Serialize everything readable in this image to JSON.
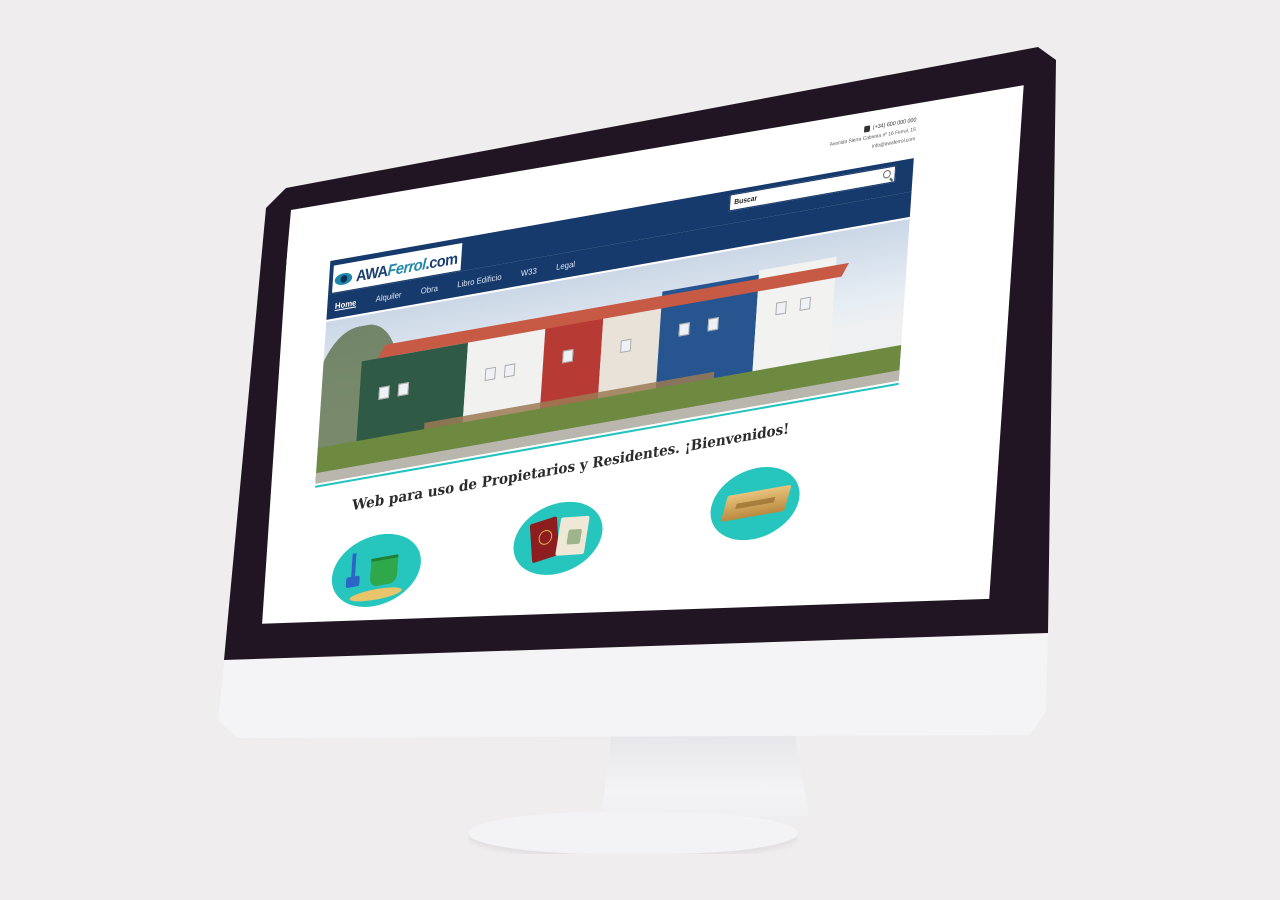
{
  "site": {
    "logo_main": "AWA",
    "logo_accent": "Ferrol",
    "logo_suffix": ".com",
    "contact": {
      "phone": "(+34) 600 000 000",
      "address": "Avenida Sierra Cabreira nº 16 Ferrol, 15",
      "email": "info@awaferrol.com"
    },
    "search": {
      "placeholder": "Buscar"
    },
    "nav": [
      {
        "label": "Home",
        "active": true
      },
      {
        "label": "Alquiler",
        "active": false
      },
      {
        "label": "Obra",
        "active": false
      },
      {
        "label": "Libro Edificio",
        "active": false
      },
      {
        "label": "W33",
        "active": false
      },
      {
        "label": "Legal",
        "active": false
      }
    ],
    "welcome": "Web para uso de Propietarios y Residentes. ¡Bienvenidos!",
    "features": [
      {
        "icon": "beach-bucket-icon"
      },
      {
        "icon": "passport-icon"
      },
      {
        "icon": "gold-sign-icon"
      }
    ],
    "colors": {
      "navy": "#163a6b",
      "accent": "#25c3bf",
      "bezel": "#211523"
    }
  }
}
